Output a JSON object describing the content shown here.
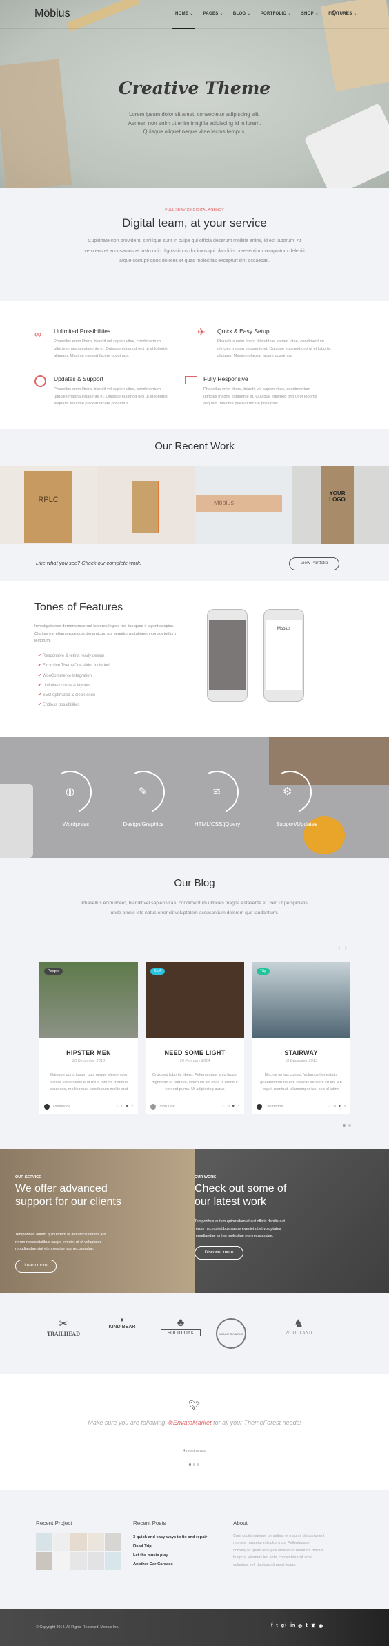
{
  "header": {
    "logo": "Möbius",
    "nav": [
      "HOME",
      "PAGES",
      "BLOG",
      "PORTFOLIO",
      "SHOP",
      "FEATURES"
    ],
    "active": "HOME",
    "search_icon": "search-icon",
    "plus_icon": "plus-icon"
  },
  "hero": {
    "title": "Creative Theme",
    "text": [
      "Lorem ipsum dolor sit amet, consectetur adipiscing elit.",
      "Aenean non enim ut enim fringilla adipiscing id in lorem.",
      "Quisque aliquet neque vitae lectus tempus."
    ]
  },
  "intro": {
    "label": "FULL SERVICE DIGITAL AGENCY",
    "heading": "Digital team, at your service",
    "text": "Cupiditate non provident, similique sunt in culpa qui officia deserunt mollitia animi, id est laborum. At vero eos et accusamus et iusto odio dignissimos ducimus qui blanditiis praesentium voluptatum deleniti atque corrupti quos dolores et quas molestias excepturi sint occaecati.",
    "accent": "#e06666"
  },
  "features": [
    {
      "icon": "infinity-icon",
      "title": "Unlimited Possibilities",
      "text": "Phasellus enim libero, blandit vel sapien vitae, condimentum ultricies magna estasente et. Quisque euismod orci ut et lobortis aliquam. Maxime placeat facere possimus."
    },
    {
      "icon": "origami-bird-icon",
      "title": "Quick & Easy Setup",
      "text": "Phasellus enim libero, blandit vel sapien vitae, condimentum ultricies magna estasente et. Quisque euismod orci ut et lobortis aliquam. Maxime placeat facere possimus."
    },
    {
      "icon": "lifebuoy-icon",
      "title": "Updates & Support",
      "text": "Phasellus enim libero, blandit vel sapien vitae, condimentum ultricies magna estasente et. Quisque euismod orci ut et lobortis aliquam. Maxime placeat facere possimus."
    },
    {
      "icon": "monitor-icon",
      "title": "Fully Responsive",
      "text": "Phasellus enim libero, blandit vel sapien vitae, condimentum ultricies magna estasente et. Quisque euismod orci ut et lobortis aliquam. Maxime placeat facere possimus."
    }
  ],
  "work": {
    "title": "Our Recent Work",
    "items": [
      "RPLC",
      "",
      "Möbius",
      "YOUR LOGO"
    ],
    "cta_text": "Like what you see? Check our complete work.",
    "cta_button": "View Portfolio"
  },
  "tones": {
    "title": "Tones of Features",
    "text": "Investigationes demonstraverunt lectores legere me lius quod ii legunt saepius. Claritas est etiam processus dynamicus, qui sequitur mutationem consuetudium lectorum.",
    "list": [
      "Responsive & retina ready design",
      "Exclusive ThemeOne slider included",
      "WooCommerce integration",
      "Unlimited colors & layouts",
      "SEO optimized & clean code",
      "Endless possibilities"
    ],
    "phone_logo": "Mobius"
  },
  "services": [
    {
      "icon": "globe-icon",
      "label": "Wordpress"
    },
    {
      "icon": "pencil-ruler-icon",
      "label": "Design/Graphics"
    },
    {
      "icon": "layers-icon",
      "label": "HTML/CSS/jQuery"
    },
    {
      "icon": "gears-icon",
      "label": "Support/Updates"
    }
  ],
  "blog": {
    "title": "Our Blog",
    "text": "Phasellus enim libero, blandit vel sapien vitae, condimentum ultricies magna estasente et. Sed ut perspiciatis unde omnis iste natus error sit voluptatem accusantium dolorem que laudantium.",
    "posts": [
      {
        "tag": "People",
        "tag_color": "#444444",
        "title": "HIPSTER MEN",
        "date": "20 December 2013",
        "text": "Quisque porta ipsum quis neque elementum lacinia. Pellentesque ut risus rutrum, tristique lacus nec, mollis risus. Vestibulum mollis erat",
        "author": "Themeone",
        "comments": "0",
        "likes": "2"
      },
      {
        "tag": "Stuff",
        "tag_color": "#29c4e0",
        "title": "NEED SOME LIGHT",
        "date": "26 February 2014",
        "text": "Cras sed lobortis libero. Pellentesque arcu lacus, dignissim ut porta in, interdum vel risus. Curabitur non est purus. Ut adipiscing purus",
        "author": "John Doe",
        "comments": "0",
        "likes": "3"
      },
      {
        "tag": "Trip",
        "tag_color": "#1fc39a",
        "title": "STAIRWAY",
        "date": "10 December 2013",
        "text": "Nec ne tantas consul. Volumus honestatis quaerendum ne est, ceteros senserit cu ius. An erguit nominati ullamcorper ius, sea id latine",
        "author": "Themeone",
        "comments": "0",
        "likes": "3"
      }
    ]
  },
  "split": {
    "left": {
      "label": "OUR SERVICE",
      "heading": "We offer advanced support for our clients",
      "text": "Temporibus autem quibusdam et aut officis debitis aut rerum necessitatibus saepe eveniet ut et voluptates repudiandae sint et molestiae non recusandae.",
      "button": "Learn more"
    },
    "right": {
      "label": "OUR WORK",
      "heading": "Check out some of our latest work",
      "text": "Temporibus autem quibusdam et aut officis debitis aut rerum necessitatibus saepe eveniet ut et voluptates repudiandae sint et molestiae non recusandae.",
      "button": "Discover more"
    }
  },
  "clients": [
    "TRAILHEAD",
    "KIND BEAR",
    "SOLID OAK",
    "MOUNT OLYMPUS",
    "WOODLAND"
  ],
  "tweet": {
    "before": "Make sure you are following ",
    "handle": "@EnvatoMarket",
    "after": " for all your ThemeForest needs!",
    "time": "4 months ago"
  },
  "footer": {
    "recent_project": "Recent Project",
    "recent_posts": "Recent Posts",
    "posts": [
      "3 quick and easy ways to fix and repair",
      "Road Trip",
      "Let the music play",
      "Another Car Carcass"
    ],
    "about": "About",
    "about_text": "Cum sociis natoque penatibus et magnis dis parturient montes, nascetur ridiculus mus. Pellentesque consequat quam et augue laoreet ac hendrerit mauris tempus. Vivamus leo ante, consectetur sit amet vulputate vel, dapibus sit amet lectus.",
    "copyright": "© Copyright 2014. All Rights Reserved. Mobius Inc.",
    "social": [
      "f",
      "t",
      "g+",
      "in",
      "◎",
      "t",
      "♜",
      "◉"
    ]
  }
}
